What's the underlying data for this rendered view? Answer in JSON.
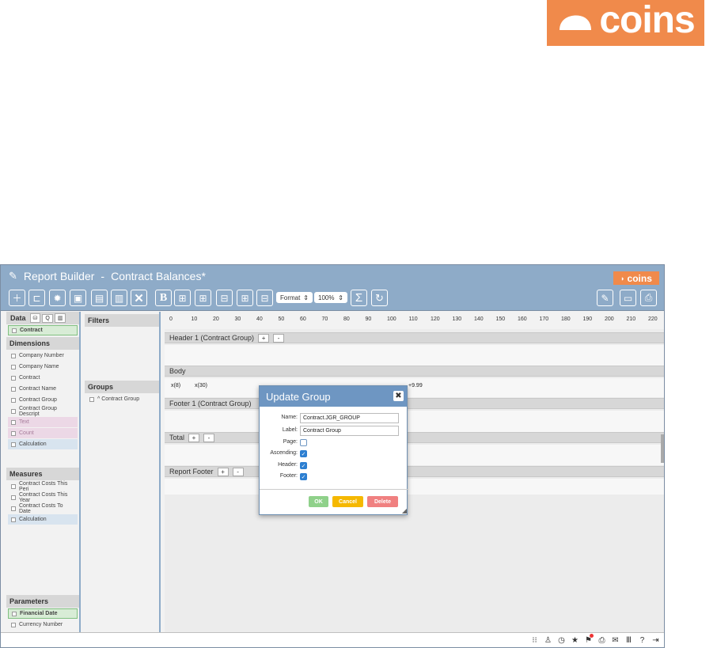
{
  "brand": {
    "name": "coins"
  },
  "window": {
    "title": "Report Builder",
    "separator": "-",
    "report": "Contract Balances*",
    "brand": "coins"
  },
  "toolbar": {
    "icons": [
      "add-icon",
      "open-folder-icon",
      "gear-icon",
      "save-icon",
      "save-as-icon",
      "delete-icon",
      "close-icon",
      "bold-icon",
      "grid1-icon",
      "grid2-icon",
      "grid3-icon",
      "grid4-icon",
      "grid5-icon"
    ],
    "format_label": "Format",
    "zoom_value": "100%",
    "sum_symbol": "Σ"
  },
  "data_pane": {
    "title": "Data",
    "datasource": "Contract",
    "dimensions_title": "Dimensions",
    "dimensions": [
      {
        "label": "Company Number",
        "style": ""
      },
      {
        "label": "Company Name",
        "style": ""
      },
      {
        "label": "Contract",
        "style": ""
      },
      {
        "label": "Contract Name",
        "style": ""
      },
      {
        "label": "Contract Group",
        "style": ""
      },
      {
        "label": "Contract Group Descript",
        "style": ""
      },
      {
        "label": "Text",
        "style": "pink"
      },
      {
        "label": "Count",
        "style": "pink"
      },
      {
        "label": "Calculation",
        "style": "blue"
      }
    ],
    "measures_title": "Measures",
    "measures": [
      {
        "label": "Contract Costs This Peri",
        "style": ""
      },
      {
        "label": "Contract Costs This Year",
        "style": ""
      },
      {
        "label": "Contract Costs To Date",
        "style": ""
      },
      {
        "label": "Calculation",
        "style": "blue"
      }
    ],
    "parameters_title": "Parameters",
    "parameters": [
      {
        "label": "Financial Date",
        "style": "green"
      },
      {
        "label": "Currency Number",
        "style": ""
      }
    ]
  },
  "group_pane": {
    "filters_title": "Filters",
    "groups_title": "Groups",
    "groups": [
      "^ Contract Group"
    ]
  },
  "design": {
    "ruler": [
      "0",
      "10",
      "20",
      "30",
      "40",
      "50",
      "60",
      "70",
      "80",
      "90",
      "100",
      "110",
      "120",
      "130",
      "140",
      "150",
      "160",
      "170",
      "180",
      "190",
      "200",
      "210",
      "220"
    ],
    "header_band": "Header 1 (Contract Group)",
    "body_band": "Body",
    "body_fields": [
      "x(8)",
      "x(30)",
      "+9.99"
    ],
    "footer_band": "Footer 1 (Contract Group)",
    "total_band": "Total",
    "report_footer_band": "Report Footer",
    "plus": "+",
    "minus": "-"
  },
  "dialog": {
    "title": "Update Group",
    "name_label": "Name:",
    "name_value": "Contract.JGR_GROUP",
    "label_label": "Label:",
    "label_value": "Contract Group",
    "page_label": "Page:",
    "page_checked": false,
    "ascending_label": "Ascending:",
    "header_label": "Header:",
    "footer_label": "Footer:",
    "ok": "OK",
    "cancel": "Cancel",
    "delete": "Delete",
    "colors": {
      "ok": "#8fd18a",
      "cancel": "#f5b800",
      "delete": "#f08080",
      "header": "#6e96c2"
    }
  },
  "statusbar": {
    "icons": [
      "apps-icon",
      "person-icon",
      "history-icon",
      "star-icon",
      "flag-icon",
      "printer-icon",
      "mail-icon",
      "library-icon",
      "help-icon",
      "logout-icon"
    ]
  }
}
